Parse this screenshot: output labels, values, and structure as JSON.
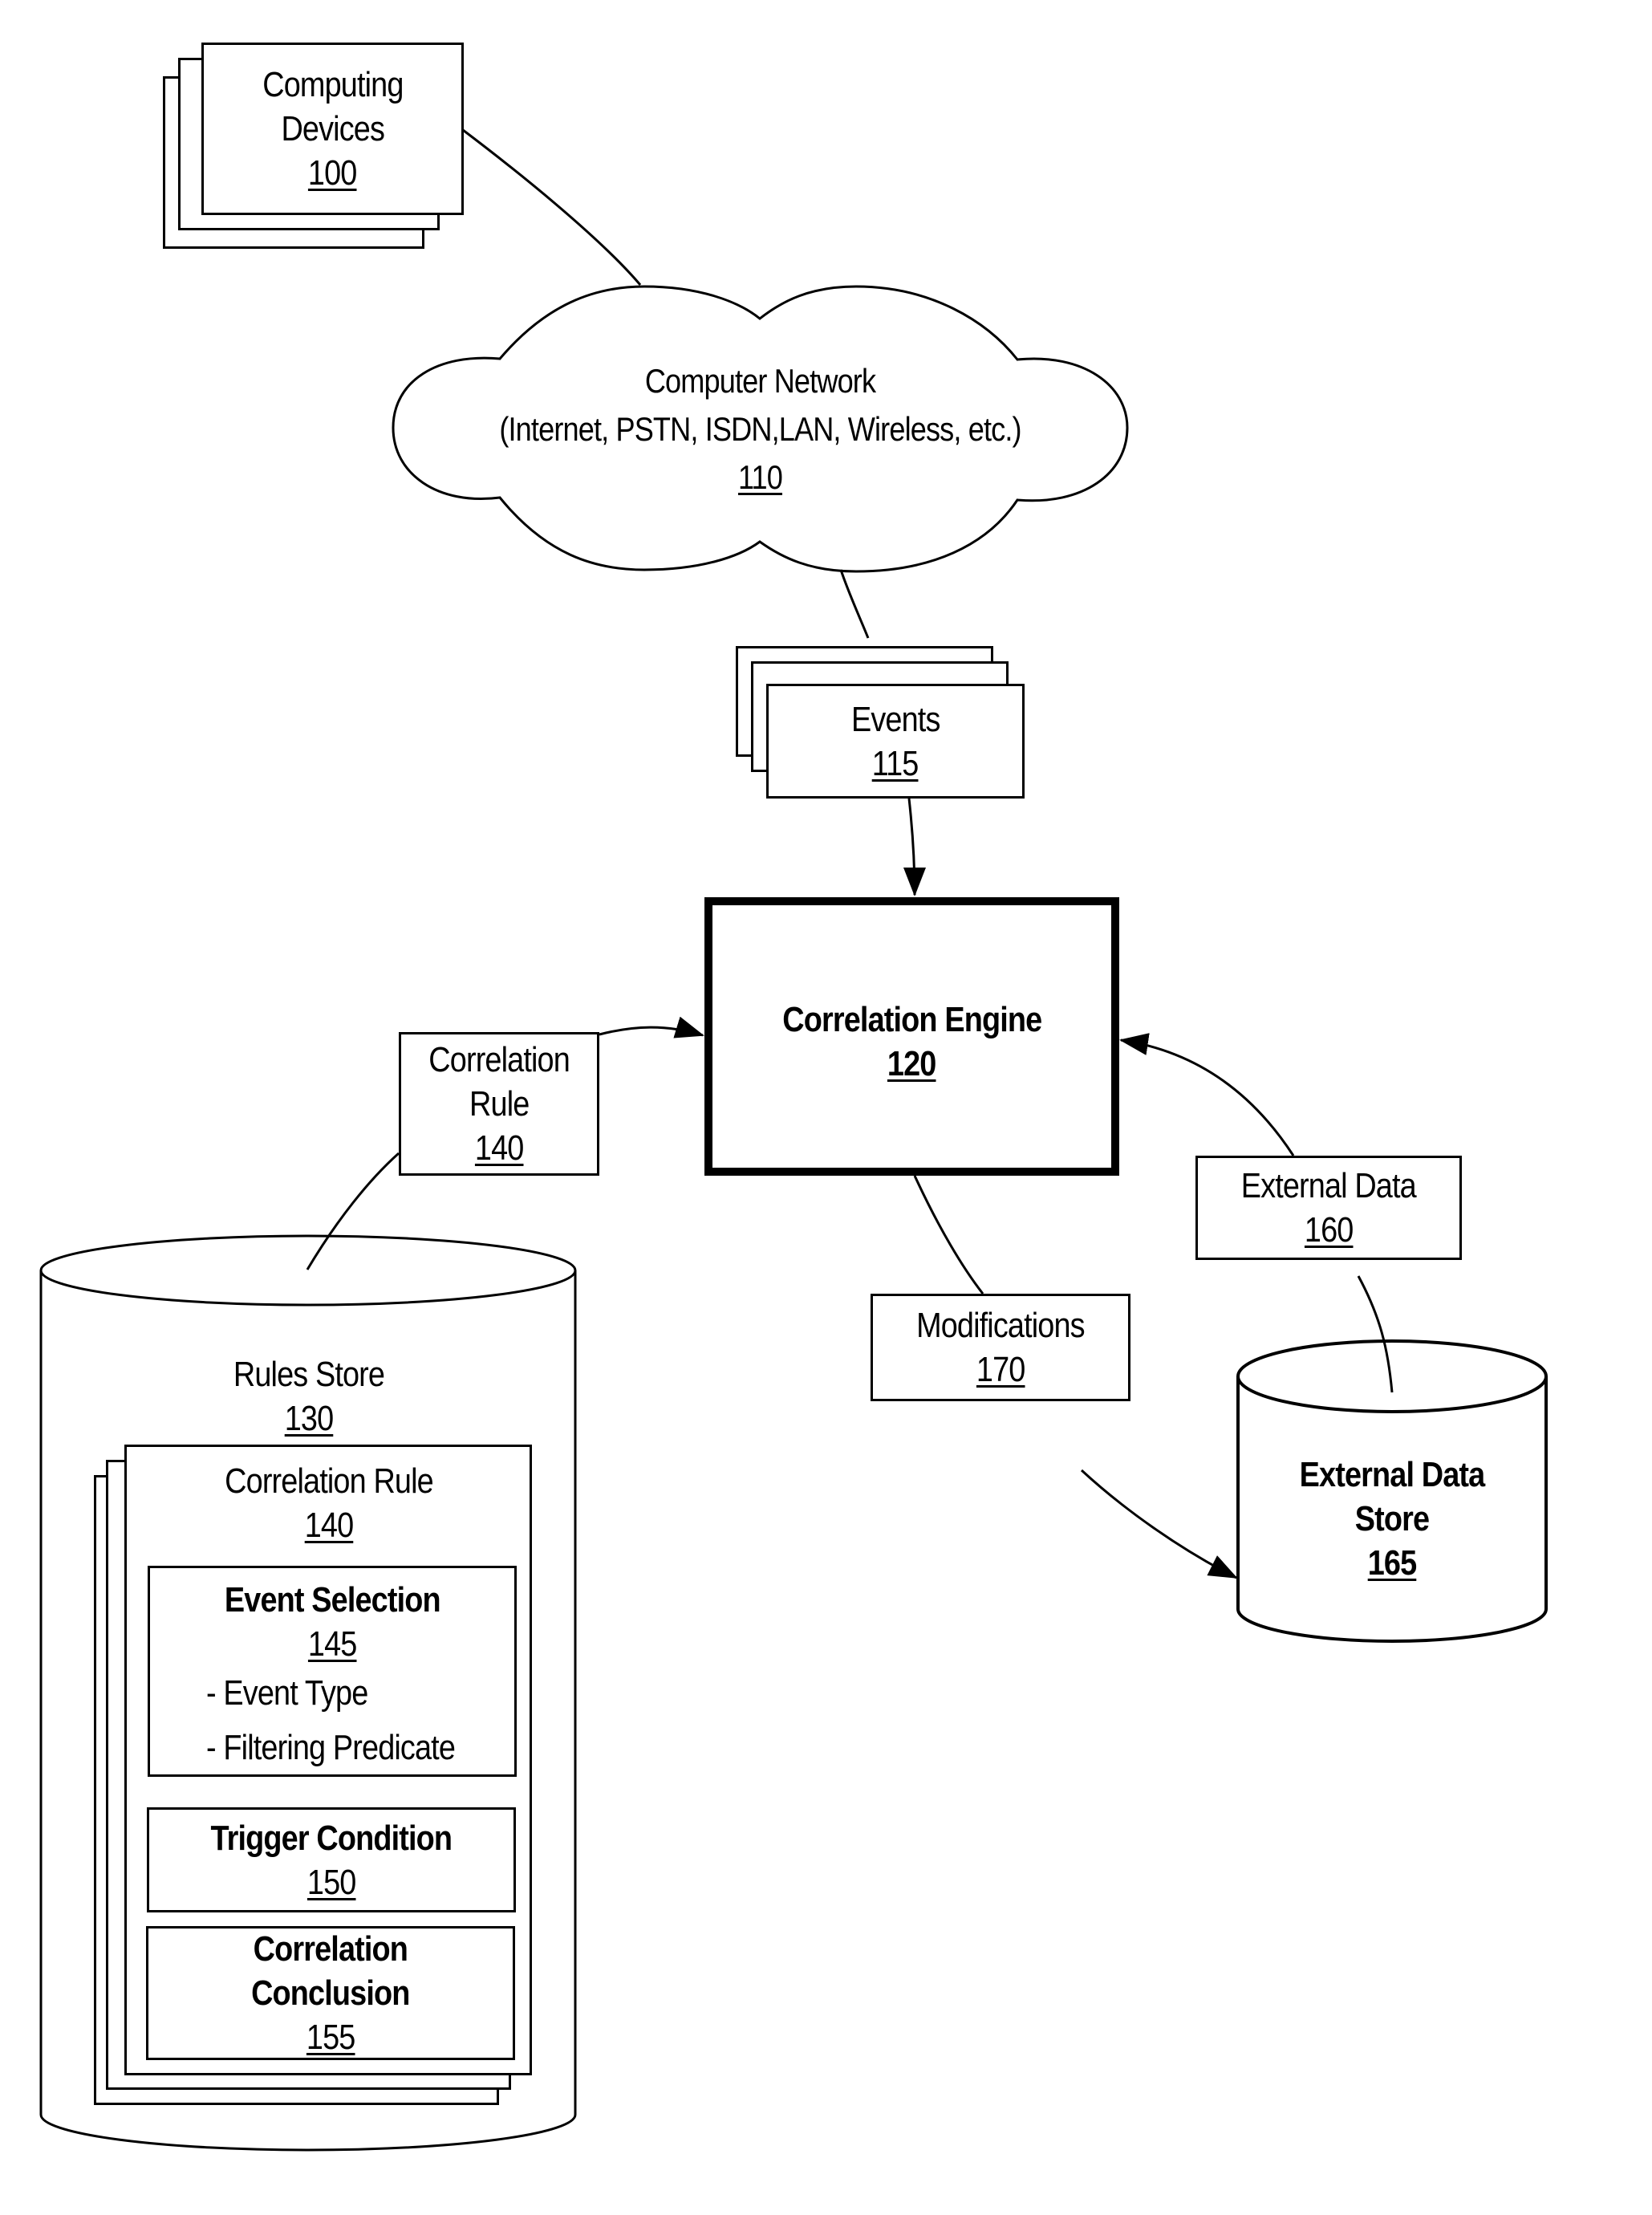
{
  "figure": {
    "computing_devices": {
      "title_line1": "Computing",
      "title_line2": "Devices",
      "ref": "100"
    },
    "network": {
      "title": "Computer Network",
      "subtitle": "(Internet, PSTN, ISDN,LAN, Wireless, etc.)",
      "ref": "110"
    },
    "events": {
      "title": "Events",
      "ref": "115"
    },
    "correlation_engine": {
      "title": "Correlation Engine",
      "ref": "120"
    },
    "correlation_rule_flow": {
      "title_line1": "Correlation",
      "title_line2": "Rule",
      "ref": "140"
    },
    "external_data": {
      "title": "External Data",
      "ref": "160"
    },
    "modifications": {
      "title": "Modifications",
      "ref": "170"
    },
    "external_data_store": {
      "title_line1": "External Data",
      "title_line2": "Store",
      "ref": "165"
    },
    "rules_store": {
      "title": "Rules Store",
      "ref": "130",
      "correlation_rule": {
        "title": "Correlation Rule",
        "ref": "140",
        "event_selection": {
          "title": "Event Selection",
          "ref": "145",
          "items": [
            "- Event Type",
            "- Filtering Predicate"
          ]
        },
        "trigger_condition": {
          "title": "Trigger Condition",
          "ref": "150"
        },
        "correlation_conclusion": {
          "title_line1": "Correlation",
          "title_line2": "Conclusion",
          "ref": "155"
        }
      }
    }
  },
  "colors": {
    "ink": "#000000",
    "paper": "#ffffff"
  }
}
